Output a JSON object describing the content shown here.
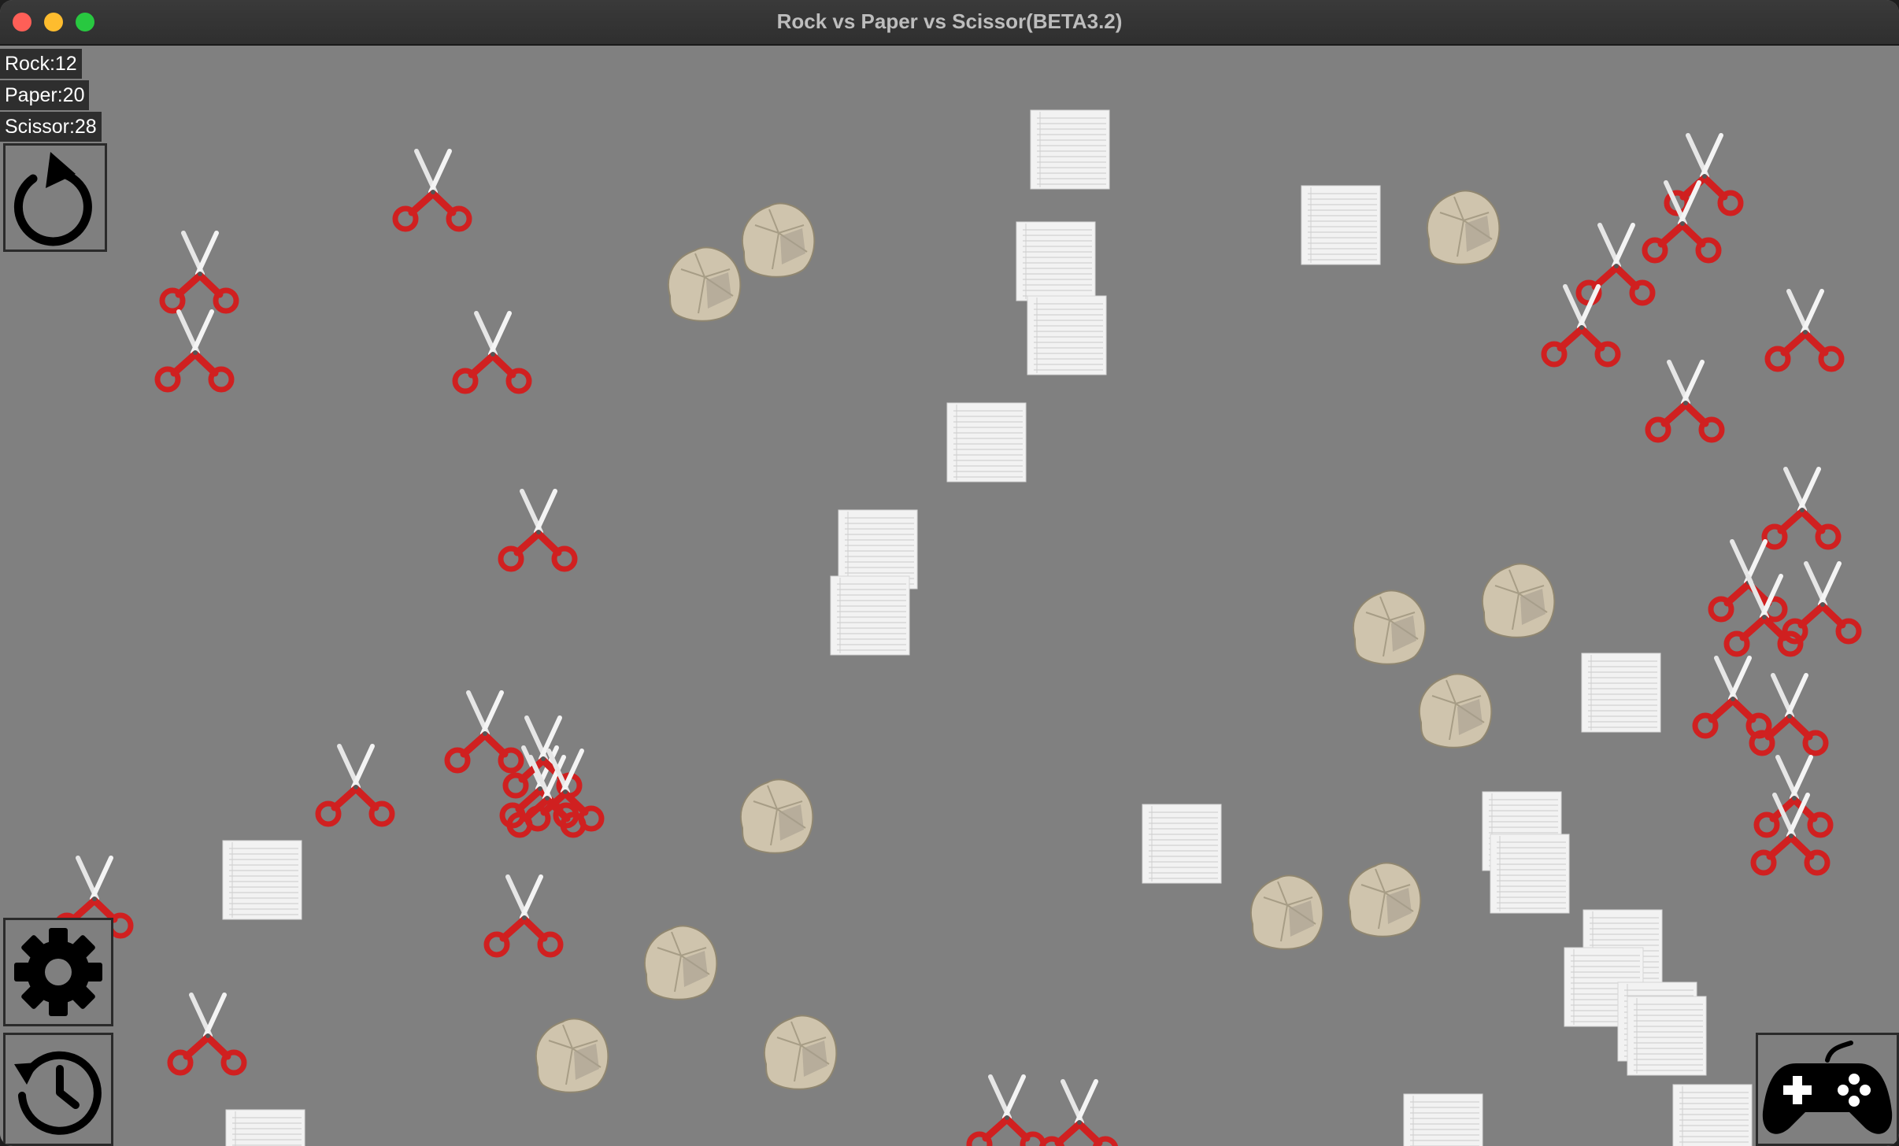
{
  "window": {
    "title": "Rock vs Paper vs Scissor(BETA3.2)"
  },
  "counters": {
    "rock": {
      "label": "Rock:",
      "value": "12"
    },
    "paper": {
      "label": "Paper:",
      "value": "20"
    },
    "scissor": {
      "label": "Scissor:",
      "value": "28"
    }
  },
  "buttons": {
    "restart": "restart-icon",
    "settings": "gear-icon",
    "history": "history-icon",
    "controller": "gamepad-icon"
  },
  "colors": {
    "background": "#808080",
    "scissor_handle": "#d02020",
    "rock": "#cfc4ad",
    "paper": "#f2f2f2"
  }
}
